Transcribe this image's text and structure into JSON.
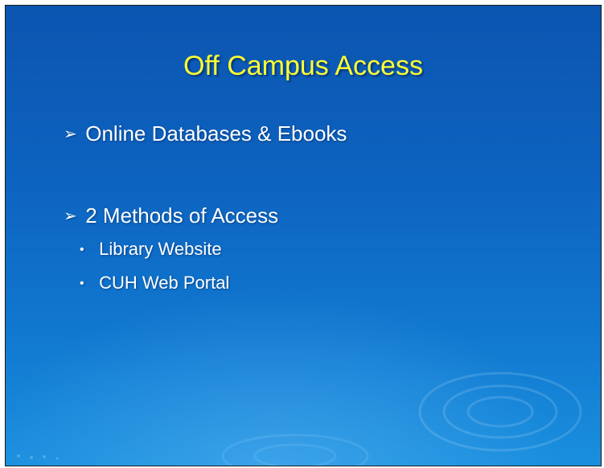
{
  "slide": {
    "title": "Off Campus Access",
    "bullets": [
      {
        "marker": "➢",
        "text": "Online Databases & Ebooks"
      },
      {
        "marker": "➢",
        "text": "2 Methods of Access",
        "subitems": [
          {
            "marker": "•",
            "text": "Library Website"
          },
          {
            "marker": "•",
            "text": "CUH Web Portal"
          }
        ]
      }
    ],
    "colors": {
      "title": "#ffff33",
      "text": "#ffffff",
      "background_top": "#0b55b0",
      "background_bottom": "#1a8fde"
    }
  }
}
